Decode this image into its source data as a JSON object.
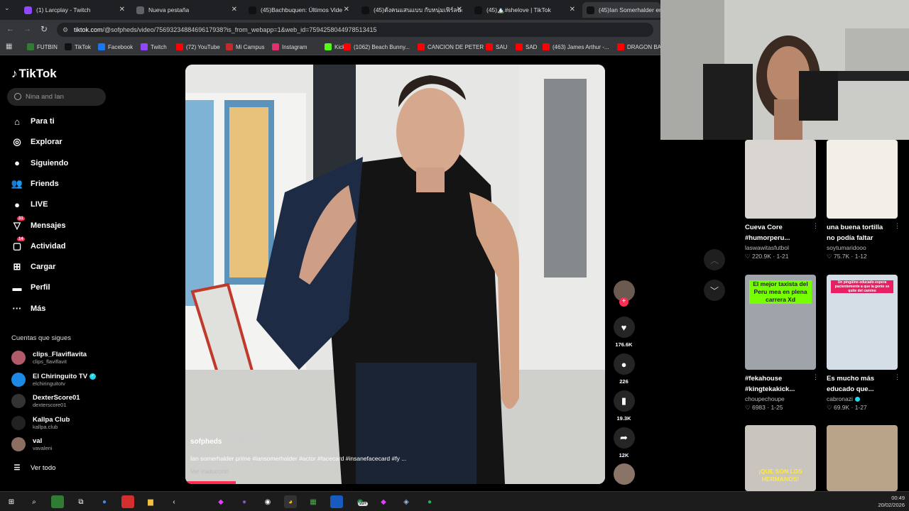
{
  "browser": {
    "tabs": [
      {
        "label": "(1) Larcplay - Twitch",
        "color": "#9146ff"
      },
      {
        "label": "Nueva pestaña",
        "color": "#5f6368"
      },
      {
        "label": "(45)Bachbuquen: Últimos Vide",
        "color": "#111111"
      },
      {
        "label": "(45)ดังคนแสนแบบ กับหนุ่มเฟิร์ลนะ",
        "color": "#111111"
      },
      {
        "label": "(45)🏔️#shelove | TikTok",
        "color": "#111111"
      },
      {
        "label": "(45)Ian Somerhalder en s",
        "color": "#111111"
      }
    ],
    "url_host": "tiktok.com",
    "url_path": "/@sofpheds/video/7569323488469617938?is_from_webapp=1&web_id=7594258044978513415",
    "bookmarks": [
      {
        "label": "FUTBIN",
        "color": "#2e7d32"
      },
      {
        "label": "TikTok",
        "color": "#111111"
      },
      {
        "label": "Facebook",
        "color": "#1877f2"
      },
      {
        "label": "Twitch",
        "color": "#9146ff"
      },
      {
        "label": "(72) YouTube",
        "color": "#ff0000"
      },
      {
        "label": "Mi Campus",
        "color": "#c62828"
      },
      {
        "label": "Instagram",
        "color": "#e1306c"
      },
      {
        "label": "Kick",
        "color": "#53fc18"
      },
      {
        "label": "(1062) Beach Bunny...",
        "color": "#ff0000"
      },
      {
        "label": "CANCION DE PETER",
        "color": "#ff0000"
      },
      {
        "label": "SAU",
        "color": "#ff0000"
      },
      {
        "label": "SAD",
        "color": "#ff0000"
      },
      {
        "label": "(463) James Arthur -...",
        "color": "#ff0000"
      },
      {
        "label": "DRAGON BAL",
        "color": "#ff0000"
      }
    ]
  },
  "sidebar": {
    "logo": "TikTok",
    "search_placeholder": "Nina and Ian",
    "nav": [
      {
        "label": "Para ti",
        "icon": "home-icon",
        "glyph": "⌂"
      },
      {
        "label": "Explorar",
        "icon": "compass-icon",
        "glyph": "◎"
      },
      {
        "label": "Siguiendo",
        "icon": "following-icon",
        "glyph": "●"
      },
      {
        "label": "Friends",
        "icon": "friends-icon",
        "glyph": "👥"
      },
      {
        "label": "LIVE",
        "icon": "live-icon",
        "glyph": "●"
      },
      {
        "label": "Mensajes",
        "icon": "messages-icon",
        "glyph": "▽",
        "badge": "31"
      },
      {
        "label": "Actividad",
        "icon": "activity-icon",
        "glyph": "▢",
        "badge": "14"
      },
      {
        "label": "Cargar",
        "icon": "upload-icon",
        "glyph": "⊞"
      },
      {
        "label": "Perfil",
        "icon": "profile-icon",
        "glyph": "▬"
      },
      {
        "label": "Más",
        "icon": "more-icon",
        "glyph": "···"
      }
    ],
    "following_header": "Cuentas que sigues",
    "accounts": [
      {
        "name": "clips_Flaviflavita",
        "handle": "clips_flaviflavit",
        "color": "#b05a6a",
        "verified": false
      },
      {
        "name": "El Chiringuito TV",
        "handle": "elchiringuitotv",
        "color": "#1e88e5",
        "verified": true
      },
      {
        "name": "DexterScore01",
        "handle": "dexterscore01",
        "color": "#333333",
        "verified": false
      },
      {
        "name": "Kallpa Club",
        "handle": "kallpa.club",
        "color": "#222222",
        "verified": false
      },
      {
        "name": "val",
        "handle": "vavaleni",
        "color": "#8d6e63",
        "verified": false
      }
    ],
    "see_all": "Ver todo"
  },
  "video": {
    "author": "sofpheds",
    "date": "· 2025-11-5",
    "caption": "Ian somerhalder prime #iansomerhalder #actor #facecard #insanefacecard #fy ...",
    "translate": "Ver traducción",
    "likes": "176.6K",
    "comments": "226",
    "saves": "19.3K",
    "shares": "12K",
    "progress": 0.12
  },
  "grid": [
    {
      "title": "Cueva Core #humorperu...",
      "user": "laswawitasfutbol",
      "stats": "♡ 220.9K · 1-21",
      "thumb": "#d9d6d2",
      "verified": false
    },
    {
      "title": "una buena tortilla no podía faltar",
      "user": "soytumaridooo",
      "stats": "♡ 75.7K · 1-12",
      "thumb": "#f2eee8",
      "verified": false
    },
    {
      "title": "#fekahouse #kingtekakick...",
      "user": "choupechoupe",
      "stats": "♡ 6983 · 1-25",
      "thumb": "#9ea4aa",
      "overlay": "El mejor taxista del Peru mea en plena carrera Xd",
      "verified": false
    },
    {
      "title": "Es mucho más educado que...",
      "user": "cabronazi",
      "stats": "♡ 69.9K · 1-27",
      "thumb": "#d5dde6",
      "overlay": "Un pingüino educado espera pacientemente a que la gente se quite del camino",
      "verified": true
    },
    {
      "title": "",
      "user": "",
      "stats": "",
      "thumb": "#c9c4bd",
      "overlay": "¡QUE SON LOS HERMANOS!",
      "verified": false
    },
    {
      "title": "",
      "user": "",
      "stats": "",
      "thumb": "#b9a48a",
      "verified": false
    }
  ],
  "taskbar": {
    "time": "00:49",
    "date": "20/02/2026",
    "badge": "99+"
  }
}
